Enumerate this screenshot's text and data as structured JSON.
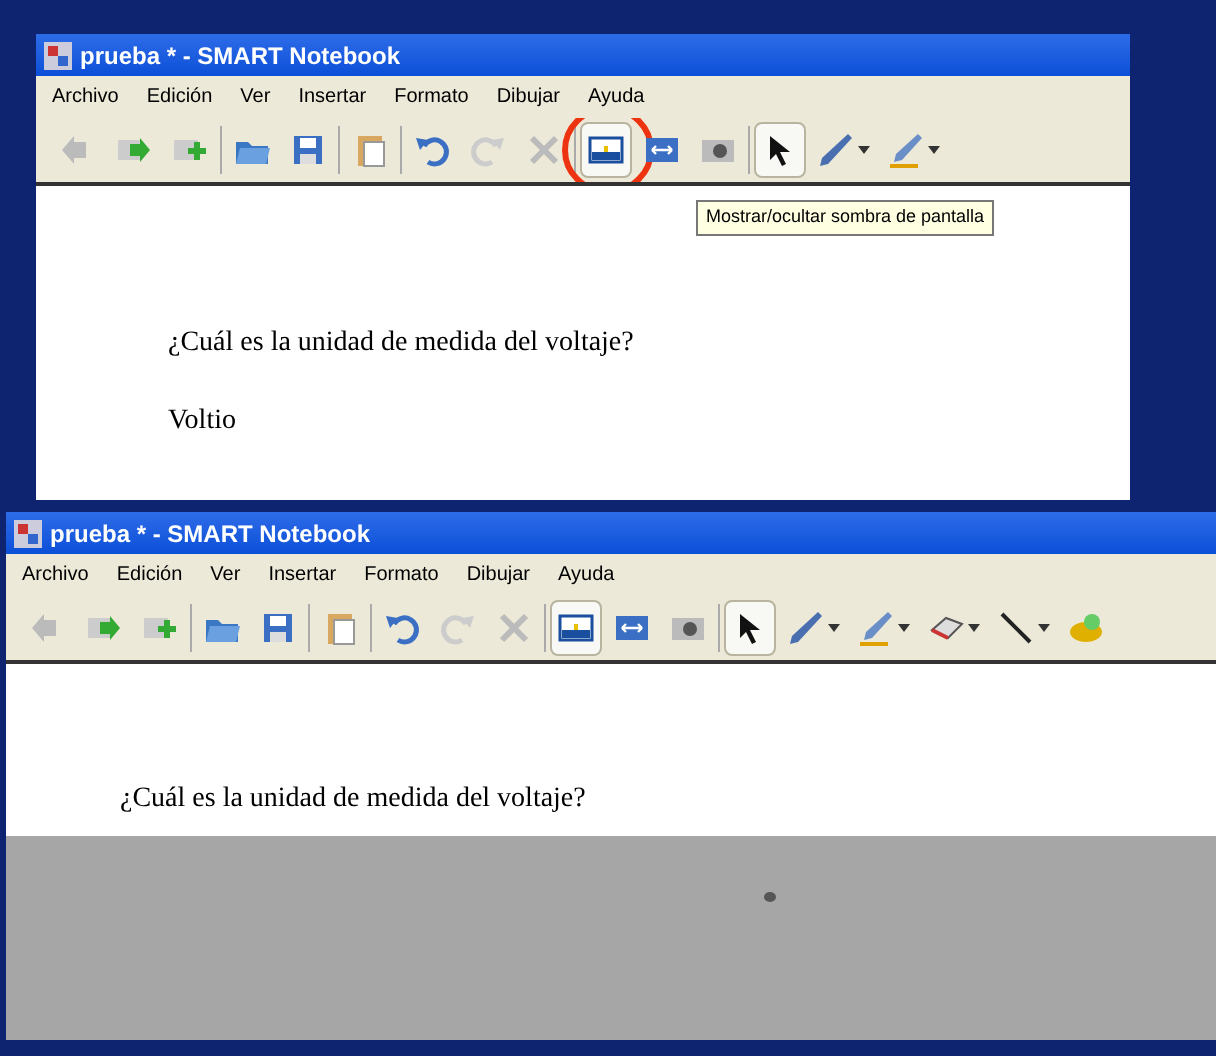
{
  "windows": [
    {
      "title": "prueba * - SMART Notebook",
      "menu": [
        "Archivo",
        "Edición",
        "Ver",
        "Insertar",
        "Formato",
        "Dibujar",
        "Ayuda"
      ],
      "tools": [
        {
          "kind": "back",
          "selected": false,
          "dropdown": false,
          "circled": false
        },
        {
          "kind": "forward",
          "selected": false,
          "dropdown": false,
          "circled": false
        },
        {
          "kind": "addpage",
          "selected": false,
          "dropdown": false,
          "circled": false
        },
        {
          "kind": "open",
          "selected": false,
          "dropdown": false,
          "circled": false
        },
        {
          "kind": "save",
          "selected": false,
          "dropdown": false,
          "circled": false
        },
        {
          "kind": "paste",
          "selected": false,
          "dropdown": false,
          "circled": false
        },
        {
          "kind": "undo",
          "selected": false,
          "dropdown": false,
          "circled": false
        },
        {
          "kind": "redo",
          "selected": false,
          "dropdown": false,
          "circled": false
        },
        {
          "kind": "delete",
          "selected": false,
          "dropdown": false,
          "circled": false
        },
        {
          "kind": "shade",
          "selected": true,
          "dropdown": false,
          "circled": true
        },
        {
          "kind": "fullscreen",
          "selected": false,
          "dropdown": false,
          "circled": false
        },
        {
          "kind": "capture",
          "selected": false,
          "dropdown": false,
          "circled": false
        },
        {
          "kind": "select",
          "selected": true,
          "dropdown": false,
          "circled": false
        },
        {
          "kind": "pen",
          "selected": false,
          "dropdown": true,
          "circled": false
        },
        {
          "kind": "highlighter",
          "selected": false,
          "dropdown": true,
          "circled": false
        }
      ],
      "tooltip": "Mostrar/ocultar sombra de pantalla",
      "question": "¿Cuál es la unidad de medida del voltaje?",
      "answer": "Voltio",
      "screen_shade": false
    },
    {
      "title": "prueba * - SMART Notebook",
      "menu": [
        "Archivo",
        "Edición",
        "Ver",
        "Insertar",
        "Formato",
        "Dibujar",
        "Ayuda"
      ],
      "tools": [
        {
          "kind": "back",
          "selected": false,
          "dropdown": false,
          "circled": false
        },
        {
          "kind": "forward",
          "selected": false,
          "dropdown": false,
          "circled": false
        },
        {
          "kind": "addpage",
          "selected": false,
          "dropdown": false,
          "circled": false
        },
        {
          "kind": "open",
          "selected": false,
          "dropdown": false,
          "circled": false
        },
        {
          "kind": "save",
          "selected": false,
          "dropdown": false,
          "circled": false
        },
        {
          "kind": "paste",
          "selected": false,
          "dropdown": false,
          "circled": false
        },
        {
          "kind": "undo",
          "selected": false,
          "dropdown": false,
          "circled": false
        },
        {
          "kind": "redo",
          "selected": false,
          "dropdown": false,
          "circled": false
        },
        {
          "kind": "delete",
          "selected": false,
          "dropdown": false,
          "circled": false
        },
        {
          "kind": "shade",
          "selected": true,
          "dropdown": false,
          "circled": false
        },
        {
          "kind": "fullscreen",
          "selected": false,
          "dropdown": false,
          "circled": false
        },
        {
          "kind": "capture",
          "selected": false,
          "dropdown": false,
          "circled": false
        },
        {
          "kind": "select",
          "selected": true,
          "dropdown": false,
          "circled": false
        },
        {
          "kind": "pen",
          "selected": false,
          "dropdown": true,
          "circled": false
        },
        {
          "kind": "highlighter",
          "selected": false,
          "dropdown": true,
          "circled": false
        },
        {
          "kind": "eraser",
          "selected": false,
          "dropdown": true,
          "circled": false
        },
        {
          "kind": "line",
          "selected": false,
          "dropdown": true,
          "circled": false
        },
        {
          "kind": "fill",
          "selected": false,
          "dropdown": false,
          "circled": false
        }
      ],
      "question": "¿Cuál es la unidad de medida del voltaje?",
      "screen_shade": true
    }
  ]
}
